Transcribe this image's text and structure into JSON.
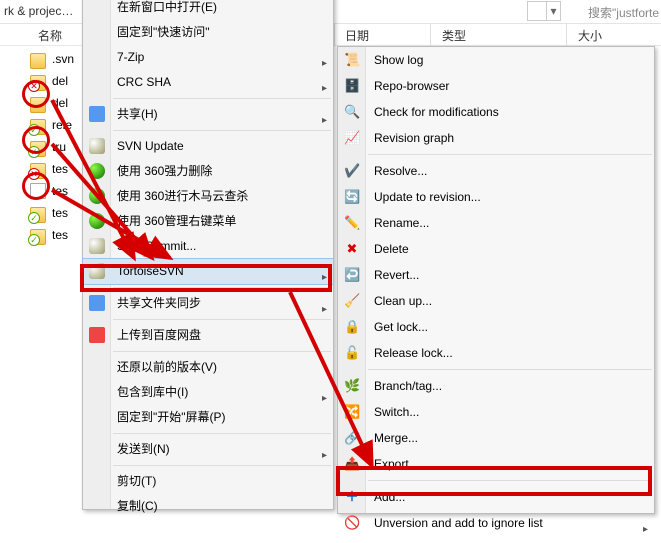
{
  "addr": {
    "crumb": "rk & projec…",
    "search_hint": "搜索\"justforte"
  },
  "columns": {
    "name": "名称",
    "date": "日期",
    "type": "类型",
    "size": "大小"
  },
  "files": [
    {
      "name": ".svn",
      "kind": "folder",
      "overlay": null
    },
    {
      "name": "del",
      "kind": "folder",
      "overlay": "del"
    },
    {
      "name": "del",
      "kind": "folder",
      "overlay": null
    },
    {
      "name": "rele",
      "kind": "folder",
      "overlay": "norm"
    },
    {
      "name": "tru",
      "kind": "folder",
      "overlay": "norm"
    },
    {
      "name": "tes",
      "kind": "folder",
      "overlay": "del"
    },
    {
      "name": "tes",
      "kind": "file",
      "overlay": null
    },
    {
      "name": "tes",
      "kind": "folder",
      "overlay": "norm"
    },
    {
      "name": "tes",
      "kind": "folder",
      "overlay": "norm"
    }
  ],
  "ctx": {
    "open_new_window": "在新窗口中打开(E)",
    "pin_quick_access": "固定到\"快速访问\"",
    "seven_zip": "7-Zip",
    "crc_sha": "CRC SHA",
    "share": "共享(H)",
    "svn_update": "SVN Update",
    "del_360": "使用 360强力删除",
    "trojan_360": "使用 360进行木马云查杀",
    "rmenu_360": "使用 360管理右键菜单",
    "svn_commit": "SVN Commit...",
    "tortoise_svn": "TortoiseSVN",
    "share_folder_sync": "共享文件夹同步",
    "upload_baidu": "上传到百度网盘",
    "restore_prev": "还原以前的版本(V)",
    "include_library": "包含到库中(I)",
    "pin_start": "固定到\"开始\"屏幕(P)",
    "send_to": "发送到(N)",
    "cut": "剪切(T)",
    "copy": "复制(C)"
  },
  "tsvn": {
    "show_log": "Show log",
    "repo_browser": "Repo-browser",
    "check_mod": "Check for modifications",
    "rev_graph": "Revision graph",
    "resolve": "Resolve...",
    "update_rev": "Update to revision...",
    "rename": "Rename...",
    "delete": "Delete",
    "revert": "Revert...",
    "clean_up": "Clean up...",
    "get_lock": "Get lock...",
    "release_lock": "Release lock...",
    "branch_tag": "Branch/tag...",
    "switch": "Switch...",
    "merge": "Merge...",
    "export": "Export...",
    "add": "Add...",
    "unversion": "Unversion and add to ignore list"
  }
}
